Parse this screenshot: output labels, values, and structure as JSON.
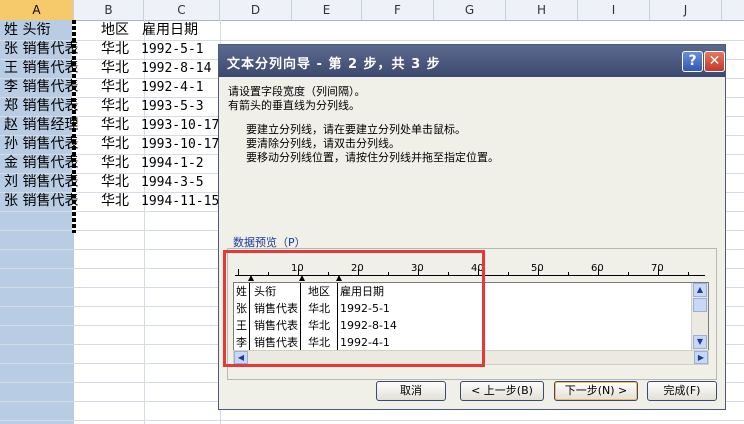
{
  "sheet": {
    "columns": [
      "A",
      "B",
      "C",
      "D",
      "E",
      "F",
      "G",
      "H",
      "I",
      "J"
    ],
    "rows": [
      {
        "a": "姓 头衔",
        "b": "地区",
        "c": "雇用日期"
      },
      {
        "a": "张 销售代表",
        "b": "华北",
        "c": "1992-5-1"
      },
      {
        "a": "王 销售代表",
        "b": "华北",
        "c": "1992-8-14"
      },
      {
        "a": "李 销售代表",
        "b": "华北",
        "c": "1992-4-1"
      },
      {
        "a": "郑 销售代表",
        "b": "华北",
        "c": "1993-5-3"
      },
      {
        "a": "赵 销售经理",
        "b": "华北",
        "c": "1993-10-17"
      },
      {
        "a": "孙 销售代表",
        "b": "华北",
        "c": "1993-10-17"
      },
      {
        "a": "金 销售代表",
        "b": "华北",
        "c": "1994-1-2"
      },
      {
        "a": "刘 销售代表",
        "b": "华北",
        "c": "1994-3-5"
      },
      {
        "a": "张 销售代表",
        "b": "华北",
        "c": "1994-11-15"
      }
    ]
  },
  "dialog": {
    "title": "文本分列向导 - 第 2 步，共 3 步",
    "help_glyph": "?",
    "close_glyph": "✕",
    "intro1": "请设置字段宽度（列间隔）。",
    "intro2": "有箭头的垂直线为分列线。",
    "tip1": "要建立分列线，请在要建立分列处单击鼠标。",
    "tip2": "要清除分列线，请双击分列线。",
    "tip3": "要移动分列线位置，请按住分列线并拖至指定位置。",
    "preview_label": "数据预览（P）",
    "ruler_numbers": [
      "10",
      "20",
      "30",
      "40",
      "50",
      "60",
      "70"
    ],
    "preview_rows": [
      {
        "c1": "姓",
        "c2": "头衔",
        "c3": "地区",
        "c4": "雇用日期"
      },
      {
        "c1": "张",
        "c2": "销售代表",
        "c3": "华北",
        "c4": "1992-5-1"
      },
      {
        "c1": "王",
        "c2": "销售代表",
        "c3": "华北",
        "c4": "1992-8-14"
      },
      {
        "c1": "李",
        "c2": "销售代表",
        "c3": "华北",
        "c4": "1992-4-1"
      }
    ],
    "buttons": {
      "cancel": "取消",
      "back": "< 上一步(B)",
      "next": "下一步(N) >",
      "finish": "完成(F)"
    }
  }
}
